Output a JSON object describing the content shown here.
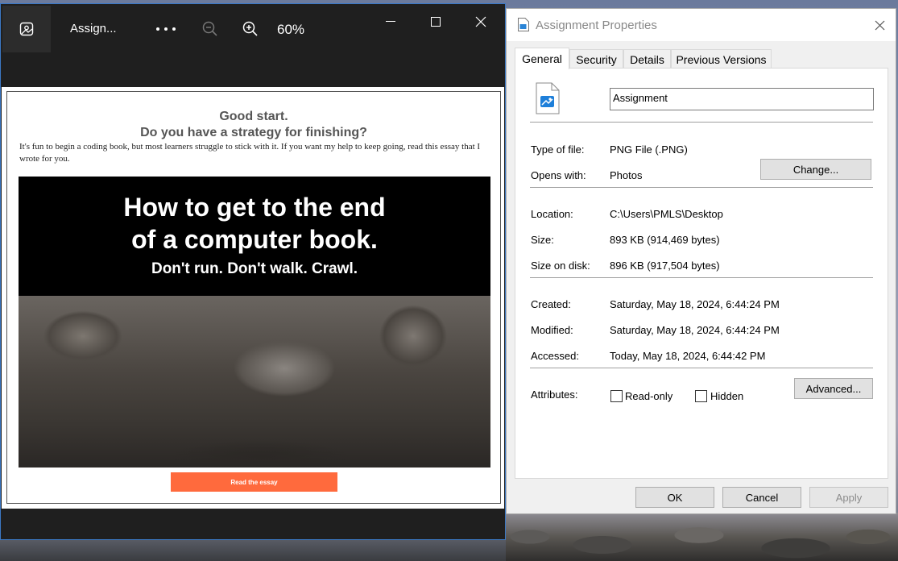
{
  "photos_viewer": {
    "file_title": "Assign...",
    "zoom_level": "60%",
    "image_content": {
      "heading_line1": "Good start.",
      "heading_line2": "Do you have a strategy for finishing?",
      "paragraph": "It's fun to begin a coding book, but most learners struggle to stick with it. If you want my help to keep going, read this essay that I wrote for you.",
      "hero_title_line1": "How to get to the end",
      "hero_title_line2": "of a computer book.",
      "hero_subtitle": "Don't run. Don't walk. Crawl.",
      "cta_button": "Read the essay"
    }
  },
  "properties_dialog": {
    "title": "Assignment Properties",
    "tabs": [
      "General",
      "Security",
      "Details",
      "Previous Versions"
    ],
    "active_tab": "General",
    "file_name": "Assignment",
    "type_label": "Type of file:",
    "type_value": "PNG File (.PNG)",
    "opens_label": "Opens with:",
    "opens_value": "Photos",
    "change_button": "Change...",
    "location_label": "Location:",
    "location_value": "C:\\Users\\PMLS\\Desktop",
    "size_label": "Size:",
    "size_value": "893 KB (914,469 bytes)",
    "size_disk_label": "Size on disk:",
    "size_disk_value": "896 KB (917,504 bytes)",
    "created_label": "Created:",
    "created_value": "Saturday, May 18, 2024, 6:44:24 PM",
    "modified_label": "Modified:",
    "modified_value": "Saturday, May 18, 2024, 6:44:24 PM",
    "accessed_label": "Accessed:",
    "accessed_value": "Today, May 18, 2024, 6:44:42 PM",
    "attributes_label": "Attributes:",
    "readonly_label": "Read-only",
    "hidden_label": "Hidden",
    "advanced_button": "Advanced...",
    "ok_button": "OK",
    "cancel_button": "Cancel",
    "apply_button": "Apply"
  },
  "colors": {
    "photos_bg": "#1f1f1f",
    "cta_orange": "#ff6a3d",
    "window_border": "#3b78c4",
    "dialog_bg": "#f0f0f0"
  }
}
